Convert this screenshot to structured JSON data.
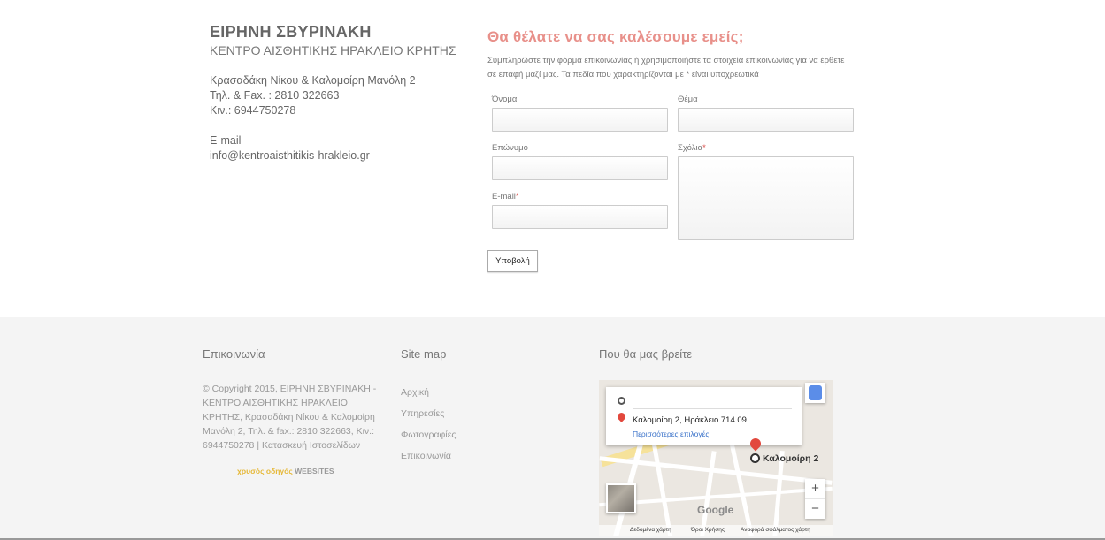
{
  "contact": {
    "name": "ΕΙΡΗΝΗ ΣΒΥΡΙΝΑΚΗ",
    "subtitle": "ΚΕΝΤΡΟ ΑΙΣΘΗΤΙΚΗΣ ΗΡΑΚΛΕΙΟ ΚΡΗΤΗΣ",
    "address": "Κρασαδάκη Νίκου & Καλομοίρη Μανόλη 2",
    "phone_fax": "Τηλ. & Fax. : 2810 322663",
    "mobile": "Κιν.: 6944750278",
    "email_label": "E-mail",
    "email": "info@kentroaisthitikis-hrakleio.gr"
  },
  "form": {
    "title": "Θα θέλατε να σας καλέσουμε εμείς;",
    "description": "Συμπληρώστε την φόρμα επικοινωνίας ή χρησιμοποιήστε τα στοιχεία επικοινωνίας για να έρθετε σε επαφή μαζί μας. Τα πεδία που χαρακτηρίζονται με * είναι υποχρεωτικά",
    "first_name_label": "Όνομα",
    "last_name_label": "Επώνυμο",
    "email_label": "E-mail",
    "subject_label": "Θέμα",
    "comments_label": "Σχόλια",
    "required_mark": "*",
    "submit_label": "Υποβολή"
  },
  "footer": {
    "contact_title": "Επικοινωνία",
    "copyright": "© Copyright 2015, ΕΙΡΗΝΗ ΣΒΥΡΙΝΑΚΗ - ΚΕΝΤΡΟ ΑΙΣΘΗΤΙΚΗΣ ΗΡΑΚΛΕΙΟ ΚΡΗΤΗΣ, Κρασαδάκη Νίκου & Καλομοίρη Μανόλη 2, Τηλ. & fax.: 2810 322663, Κιν.: 6944750278 | Κατασκευή Ιστοσελίδων",
    "brand_part1": "χρυσός οδηγός",
    "brand_part2": "WEBSITES",
    "sitemap_title": "Site map",
    "sitemap_links": [
      "Αρχική",
      "Υπηρεσίες",
      "Φωτογραφίες",
      "Επικοινωνία"
    ],
    "map_title": "Που θα μας βρείτε"
  },
  "map": {
    "destination": "Καλομοίρη 2, Ηράκλειο 714 09",
    "more_options": "Περισσότερες επιλογές",
    "marker_label": "Καλομοίρη 2",
    "zoom_in": "+",
    "zoom_out": "−",
    "logo": "Google",
    "attribution_data": "Δεδομένα χάρτη",
    "attribution_terms": "Όροι Χρήσης",
    "attribution_report": "Αναφορά σφάλματος χάρτη",
    "accent_color": "#e2483d",
    "link_color": "#3a72c9"
  },
  "colors": {
    "title_pink": "#e8908a",
    "footer_bg": "#f4f4f4"
  }
}
